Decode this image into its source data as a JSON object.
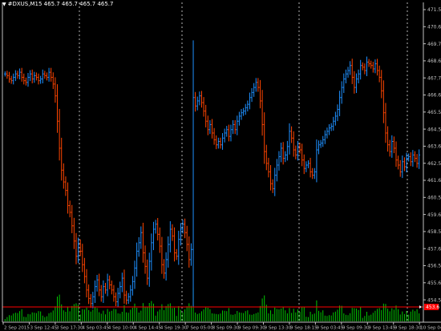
{
  "header": {
    "symbol": "#DXUS,M15",
    "ohlc": "465.7 465.7 465.7 465.7"
  },
  "colors": {
    "background": "#000000",
    "axis": "#c0c0c0",
    "grid": "#ffffff",
    "bull": "#1e90ff",
    "bear": "#ff4500",
    "volume": "#00c800",
    "price_line": "#ff0000",
    "price_tag_bg": "#ff0000"
  },
  "chart_data": {
    "type": "bar",
    "style": "ohlc-bars",
    "title": "",
    "xlabel": "",
    "ylabel": "",
    "ylim": [
      453.9,
      471.8
    ],
    "current_price": "453.6",
    "price_axis_labels": [
      "471.5",
      "470.6",
      "469.7",
      "468.6",
      "467.7",
      "466.6",
      "465.5",
      "464.5",
      "463.6",
      "462.5",
      "461.6",
      "460.5",
      "459.6",
      "458.5",
      "457.6",
      "456.5",
      "455.6",
      "454.5"
    ],
    "time_axis_labels": [
      "2 Sep 2015",
      "3 Sep 12:45",
      "3 Sep 17:30",
      "4 Sep 03:45",
      "4 Sep 10:00",
      "4 Sep 14:45",
      "4 Sep 19:30",
      "7 Sep 05:00",
      "8 Sep 09:30",
      "9 Sep 09:30",
      "9 Sep 13:30",
      "9 Sep 18:15",
      "9 Sep 03:45",
      "9 Sep 09:30",
      "9 Sep 13:45",
      "9 Sep 18:30",
      "10 Sep 04:00"
    ],
    "grid": "vertical-dotted",
    "close_series": [
      467.8,
      467.7,
      467.5,
      467.4,
      467.6,
      467.8,
      467.7,
      467.9,
      467.6,
      467.4,
      467.3,
      467.6,
      467.8,
      467.5,
      467.7,
      467.6,
      467.4,
      467.5,
      467.8,
      467.7,
      467.6,
      467.9,
      467.6,
      467.2,
      466.5,
      465.0,
      463.4,
      462.1,
      461.4,
      460.9,
      460.0,
      459.6,
      458.8,
      457.9,
      457.0,
      457.7,
      457.3,
      456.5,
      455.8,
      455.0,
      454.5,
      454.2,
      454.6,
      455.2,
      455.6,
      455.0,
      454.6,
      455.2,
      455.0,
      455.6,
      455.3,
      455.0,
      454.6,
      454.3,
      454.8,
      455.2,
      455.7,
      454.7,
      454.4,
      454.6,
      455.0,
      455.5,
      456.3,
      457.3,
      457.8,
      458.4,
      457.2,
      456.4,
      455.7,
      456.7,
      457.8,
      458.6,
      458.9,
      458.3,
      457.6,
      456.5,
      456.0,
      456.8,
      457.7,
      458.6,
      458.2,
      457.2,
      457.0,
      458.0,
      458.6,
      458.9,
      458.4,
      457.7,
      456.8,
      457.4,
      466.4,
      465.9,
      466.2,
      466.5,
      466.1,
      465.6,
      465.0,
      464.5,
      464.8,
      464.3,
      463.9,
      463.6,
      463.8,
      463.6,
      464.0,
      464.3,
      464.5,
      464.1,
      464.5,
      464.8,
      464.5,
      465.0,
      465.3,
      465.5,
      465.6,
      465.8,
      466.0,
      466.4,
      466.7,
      467.0,
      467.3,
      467.0,
      466.2,
      464.8,
      463.2,
      462.5,
      462.0,
      461.3,
      461.0,
      461.8,
      462.4,
      462.9,
      463.4,
      462.8,
      463.0,
      463.5,
      464.4,
      464.0,
      463.3,
      463.0,
      463.5,
      463.3,
      462.7,
      462.2,
      462.4,
      462.5,
      462.0,
      461.8,
      462.0,
      463.3,
      463.6,
      463.7,
      463.9,
      464.2,
      464.4,
      464.6,
      464.7,
      465.0,
      465.3,
      465.7,
      466.4,
      467.0,
      467.5,
      467.8,
      468.0,
      468.3,
      467.6,
      467.0,
      467.5,
      467.8,
      468.3,
      468.2,
      468.0,
      468.5,
      468.4,
      468.3,
      468.1,
      468.4,
      468.0,
      467.6,
      466.8,
      465.5,
      464.3,
      463.6,
      463.2,
      463.8,
      463.4,
      462.7,
      462.4,
      462.0,
      462.6,
      462.3,
      462.8,
      462.9,
      462.6,
      463.0,
      462.8,
      462.5,
      463.0
    ]
  }
}
